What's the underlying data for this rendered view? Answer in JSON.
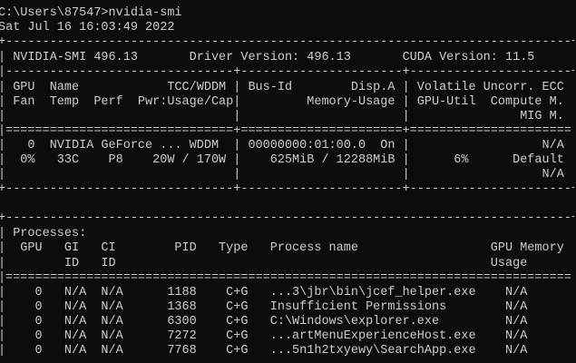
{
  "terminal": {
    "background": "#0c0c0c",
    "foreground": "#cccccc",
    "lines": [
      "C:\\Users\\87547>nvidia-smi",
      "Sat Jul 16 16:03:49 2022",
      "+-----------------------------------------------------------------------------+",
      "| NVIDIA-SMI 496.13       Driver Version: 496.13       CUDA Version: 11.5     |",
      "|-------------------------------+----------------------+----------------------+",
      "| GPU  Name            TCC/WDDM | Bus-Id        Disp.A | Volatile Uncorr. ECC |",
      "| Fan  Temp  Perf  Pwr:Usage/Cap|         Memory-Usage | GPU-Util  Compute M. |",
      "|                               |                      |               MIG M. |",
      "|===============================+======================+======================|",
      "|   0  NVIDIA GeForce ... WDDM  | 00000000:01:00.0  On |                  N/A |",
      "|  0%   33C    P8    20W / 170W |    625MiB / 12288MiB |      6%      Default |",
      "|                               |                      |                  N/A |",
      "+-------------------------------+----------------------+----------------------+",
      "",
      "+-----------------------------------------------------------------------------+",
      "| Processes:                                                                  |",
      "|  GPU   GI   CI        PID   Type   Process name                  GPU Memory |",
      "|        ID   ID                                                   Usage      |",
      "|=============================================================================|",
      "|    0   N/A  N/A      1188    C+G   ...3\\jbr\\bin\\jcef_helper.exe    N/A      |",
      "|    0   N/A  N/A      1368    C+G   Insufficient Permissions        N/A      |",
      "|    0   N/A  N/A      6300    C+G   C:\\Windows\\explorer.exe         N/A      |",
      "|    0   N/A  N/A      7272    C+G   ...artMenuExperienceHost.exe    N/A      |",
      "|    0   N/A  N/A      7768    C+G   ...5n1h2txyewy\\SearchApp.exe    N/A      |"
    ]
  }
}
